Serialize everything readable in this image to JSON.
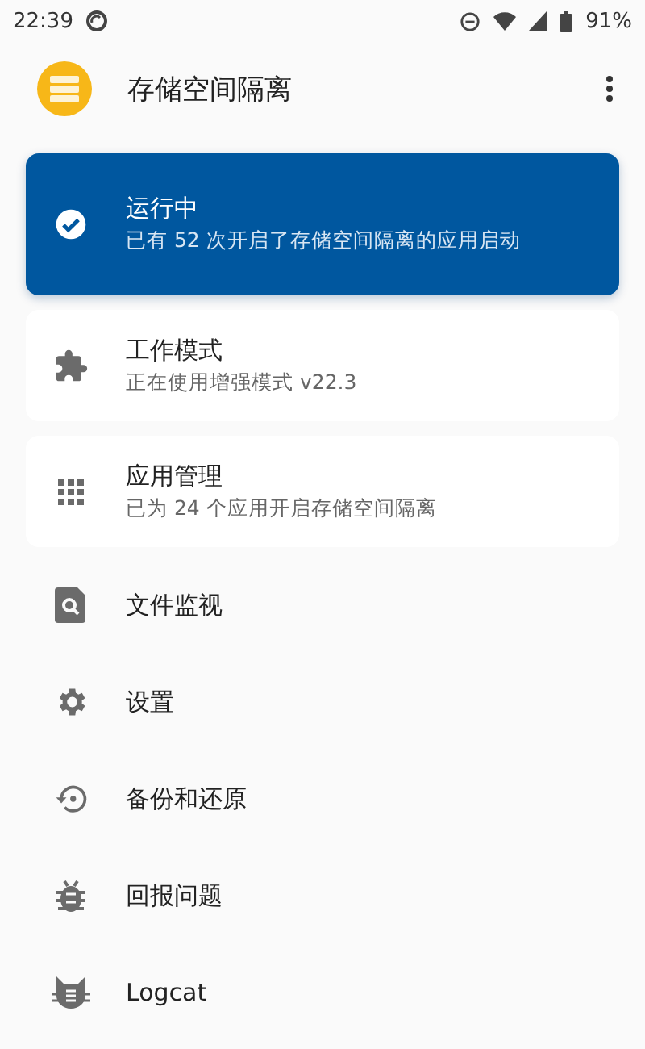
{
  "status_bar": {
    "time": "22:39",
    "battery": "91%"
  },
  "app_bar": {
    "title": "存储空间隔离"
  },
  "cards": [
    {
      "kind": "status",
      "title": "运行中",
      "subtitle": "已有 52 次开启了存储空间隔离的应用启动"
    },
    {
      "kind": "info",
      "title": "工作模式",
      "subtitle": "正在使用增强模式 v22.3"
    },
    {
      "kind": "info",
      "title": "应用管理",
      "subtitle": "已为 24 个应用开启存储空间隔离"
    }
  ],
  "menu": [
    {
      "label": "文件监视"
    },
    {
      "label": "设置"
    },
    {
      "label": "备份和还原"
    },
    {
      "label": "回报问题"
    },
    {
      "label": "Logcat"
    }
  ]
}
